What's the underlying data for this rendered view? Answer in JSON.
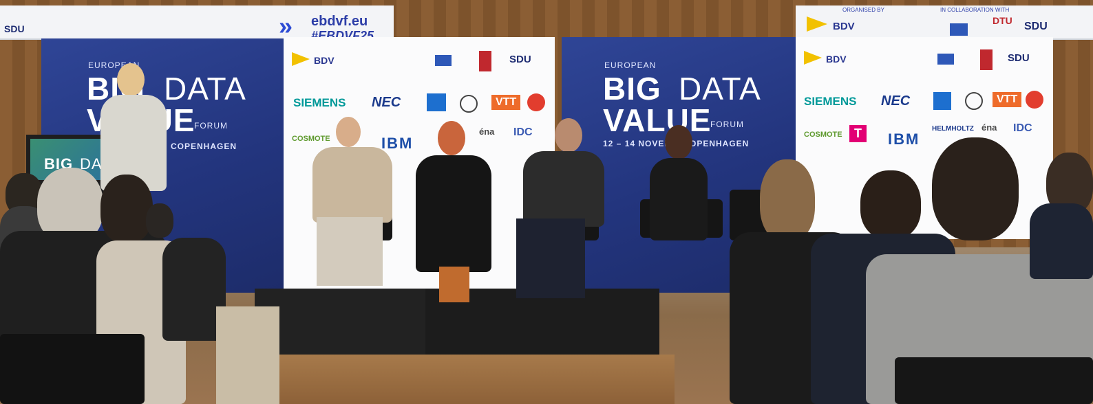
{
  "screen_left": {
    "sdu_logo": "SDU",
    "url": "ebdvf.eu",
    "hashtag": "#EBDVF25"
  },
  "screen_right": {
    "organised_by": "ORGANISED BY",
    "in_collaboration": "IN COLLABORATION WITH",
    "bdv_logo": "BDV",
    "dtu_logo": "DTU",
    "sdu_logo": "SDU"
  },
  "backdrop_left": {
    "line1": "EUROPEAN",
    "big": "BIG",
    "data": "DATA",
    "value": "VALUE",
    "forum": "FORUM",
    "location": "COPENHAGEN"
  },
  "backdrop_right": {
    "line1": "EUROPEAN",
    "big": "BIG",
    "data": "DATA",
    "value": "VALUE",
    "forum": "FORUM",
    "dates": "12 – 14 NOVEMB",
    "location": "OPENHAGEN"
  },
  "sponsor_wall_left": {
    "bdv": "BDV",
    "sdu": "SDU",
    "siemens": "SIEMENS",
    "nec": "NEC",
    "vtt": "VTT",
    "idc": "IDC",
    "cosmote": "COSMOTE",
    "ibm": "IBM",
    "ena": "éna"
  },
  "sponsor_wall_right": {
    "bdv": "BDV",
    "sdu": "SDU",
    "siemens": "SIEMENS",
    "nec": "NEC",
    "vtt": "VTT",
    "idc": "IDC",
    "cosmote": "COSMOTE",
    "ibm": "IBM",
    "t_logo": "T",
    "ena": "éna",
    "helmholtz": "HELMHOLTZ"
  },
  "podium": {
    "big": "BIG",
    "data": "DATA"
  }
}
